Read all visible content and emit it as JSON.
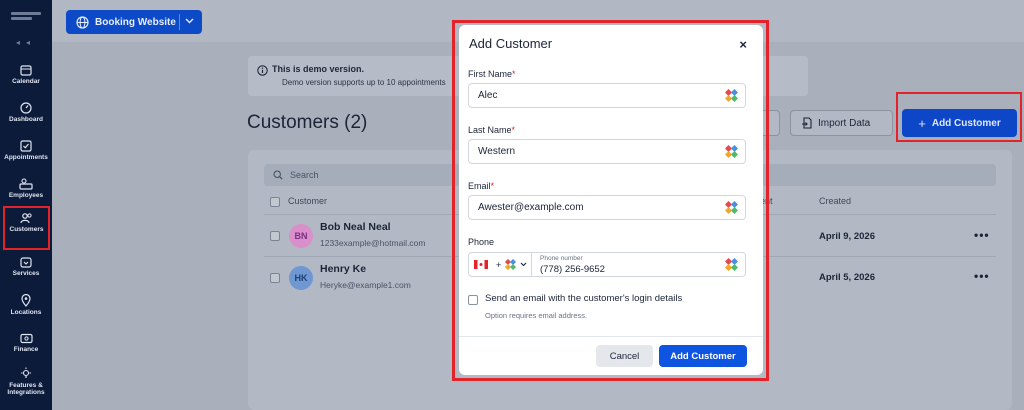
{
  "sidebar": {
    "items": [
      {
        "label": "Calendar",
        "icon": "calendar-icon"
      },
      {
        "label": "Dashboard",
        "icon": "dashboard-icon"
      },
      {
        "label": "Appointments",
        "icon": "appointments-icon"
      },
      {
        "label": "Employees",
        "icon": "employees-icon"
      },
      {
        "label": "Customers",
        "icon": "customers-icon"
      },
      {
        "label": "Services",
        "icon": "services-icon"
      },
      {
        "label": "Locations",
        "icon": "location-pin-icon"
      },
      {
        "label": "Finance",
        "icon": "finance-icon"
      },
      {
        "label": "Features &",
        "icon": "features-icon"
      },
      {
        "label": "Integrations",
        "icon": "integrations-icon"
      }
    ]
  },
  "header": {
    "booking_label": "Booking Website"
  },
  "demo": {
    "title": "This is demo version.",
    "text": "Demo version supports up to 10 appointments"
  },
  "page": {
    "title": "Customers (2)",
    "import_label": "Import Data",
    "add_label": "Add Customer"
  },
  "table": {
    "search_placeholder": "Search",
    "headers": {
      "customer": "Customer",
      "appointment_partial": "ent",
      "created": "Created"
    },
    "rows": [
      {
        "name": "Bob Neal Neal",
        "email": "1233example@hotmail.com",
        "initials": "BN",
        "created": "April 9, 2026"
      },
      {
        "name": "Henry Ke",
        "email": "Heryke@example1.com",
        "initials": "HK",
        "created": "April 5, 2026"
      }
    ],
    "more": "•••"
  },
  "modal": {
    "title": "Add Customer",
    "close": "×",
    "first_name_label": "First Name",
    "first_name_value": "Alec",
    "last_name_label": "Last Name",
    "last_name_value": "Western",
    "email_label": "Email",
    "email_value": "Awester@example.com",
    "phone_label": "Phone",
    "phone_placeholder": "Phone number",
    "phone_value": "(778) 256-9652",
    "phone_prefix": "+",
    "required_mark": "*",
    "send_email_label": "Send an email with the customer's login details",
    "send_email_hint": "Option requires email address.",
    "cancel_label": "Cancel",
    "submit_label": "Add Customer"
  },
  "colors": {
    "accent": "#0d55e0",
    "highlight": "#e2242a",
    "sidebar_bg": "#0d1b3a"
  }
}
